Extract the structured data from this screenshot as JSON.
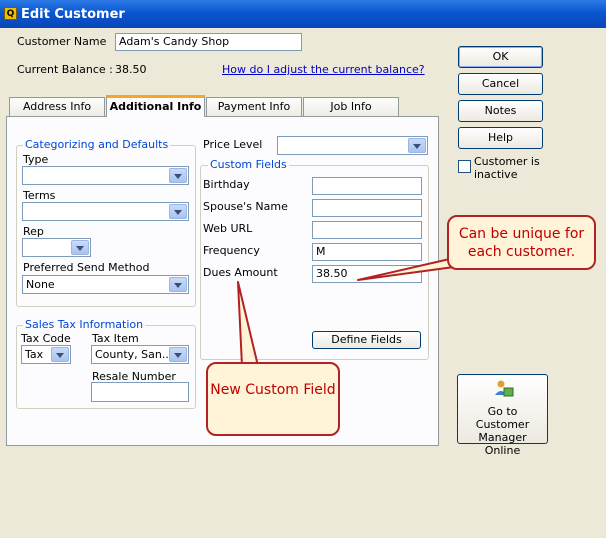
{
  "window": {
    "title": "Edit Customer"
  },
  "header": {
    "customer_name_label": "Customer Name",
    "customer_name_value": "Adam's Candy Shop",
    "current_balance_label": "Current Balance :",
    "current_balance_value": "38.50",
    "adjust_balance_link": "How do I adjust the current balance?"
  },
  "tabs": [
    {
      "label": "Address Info"
    },
    {
      "label": "Additional Info"
    },
    {
      "label": "Payment Info"
    },
    {
      "label": "Job Info"
    }
  ],
  "categorizing": {
    "legend": "Categorizing and Defaults",
    "type_label": "Type",
    "type_value": "",
    "terms_label": "Terms",
    "terms_value": "",
    "rep_label": "Rep",
    "rep_value": "",
    "send_method_label": "Preferred Send Method",
    "send_method_value": "None"
  },
  "sales_tax": {
    "legend": "Sales Tax Information",
    "tax_code_label": "Tax Code",
    "tax_code_value": "Tax",
    "tax_item_label": "Tax Item",
    "tax_item_value": "County, San...",
    "resale_label": "Resale Number",
    "resale_value": ""
  },
  "price_level": {
    "label": "Price Level",
    "value": ""
  },
  "custom_fields": {
    "legend": "Custom Fields",
    "fields": [
      {
        "label": "Birthday",
        "value": ""
      },
      {
        "label": "Spouse's Name",
        "value": ""
      },
      {
        "label": "Web URL",
        "value": ""
      },
      {
        "label": "Frequency",
        "value": "M"
      },
      {
        "label": "Dues Amount",
        "value": "38.50"
      }
    ],
    "define_button": "Define Fields"
  },
  "side_buttons": {
    "ok": "OK",
    "cancel": "Cancel",
    "notes": "Notes",
    "help": "Help",
    "inactive_label": "Customer is inactive",
    "manager": "Go to Customer Manager Online"
  },
  "callouts": {
    "unique": "Can be unique for each customer.",
    "new_field": "New Custom Field"
  },
  "colors": {
    "title_bar": "#0a56d0",
    "callout_border": "#b32222",
    "callout_text": "#c00000",
    "legend_text": "#0046d5",
    "active_tab_accent": "#f6a623"
  }
}
